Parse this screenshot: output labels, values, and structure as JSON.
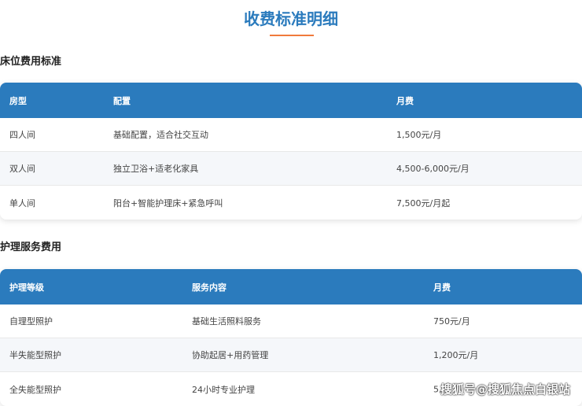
{
  "title": "收费标准明细",
  "bed": {
    "heading": "床位费用标准",
    "headers": [
      "房型",
      "配置",
      "月费"
    ],
    "rows": [
      [
        "四人间",
        "基础配置，适合社交互动",
        "1,500元/月"
      ],
      [
        "双人间",
        "独立卫浴+适老化家具",
        "4,500-6,000元/月"
      ],
      [
        "单人间",
        "阳台+智能护理床+紧急呼叫",
        "7,500元/月起"
      ]
    ]
  },
  "care": {
    "heading": "护理服务费用",
    "headers": [
      "护理等级",
      "服务内容",
      "月费"
    ],
    "rows": [
      [
        "自理型照护",
        "基础生活照料服务",
        "750元/月"
      ],
      [
        "半失能型照护",
        "协助起居+用药管理",
        "1,200元/月"
      ],
      [
        "全失能型照护",
        "24小时专业护理",
        "5,"
      ]
    ]
  },
  "watermark": "搜狐号@搜狐焦点白银站"
}
